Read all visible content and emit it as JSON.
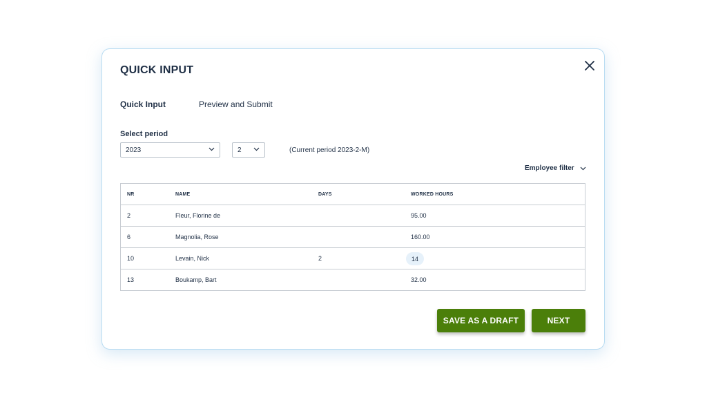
{
  "modal": {
    "title": "QUICK INPUT",
    "close_icon": "close-icon"
  },
  "tabs": [
    {
      "label": "Quick Input",
      "active": true
    },
    {
      "label": "Preview and Submit",
      "active": false
    }
  ],
  "period": {
    "label": "Select period",
    "year": "2023",
    "month": "2",
    "current": "(Current period 2023-2-M)"
  },
  "employee_filter": {
    "label": "Employee filter",
    "icon": "chevron-down-icon"
  },
  "table": {
    "headers": [
      "NR",
      "NAME",
      "DAYS",
      "WORKED HOURS"
    ],
    "rows": [
      {
        "nr": "2",
        "name": "Fleur, Florine de",
        "days": "",
        "hours": "95.00"
      },
      {
        "nr": "6",
        "name": "Magnolia, Rose",
        "days": "",
        "hours": "160.00"
      },
      {
        "nr": "10",
        "name": "Levain, Nick",
        "days": "2",
        "hours": "14"
      },
      {
        "nr": "13",
        "name": "Boukamp, Bart",
        "days": "",
        "hours": "32.00"
      }
    ]
  },
  "buttons": {
    "draft": "SAVE AS A DRAFT",
    "next": "NEXT"
  },
  "colors": {
    "primary_button": "#4b7f0a",
    "text": "#1f2f45",
    "modal_border": "#b9dcf2",
    "edit_highlight": "#e6f1fa"
  }
}
